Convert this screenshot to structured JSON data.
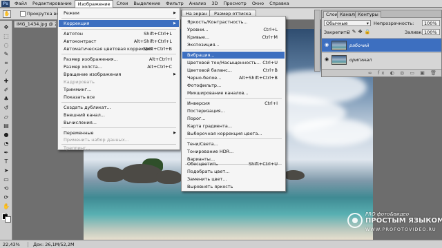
{
  "menubar": {
    "logo": "Ps",
    "items": [
      "Файл",
      "Редактирование",
      "Изображение",
      "Слои",
      "Выделение",
      "Фильтр",
      "Анализ",
      "3D",
      "Просмотр",
      "Окно",
      "Справка"
    ]
  },
  "options": {
    "checkbox_label": "Прокрутка во вс...",
    "btn_screen": "На экран",
    "btn_print": "Размер оттиска"
  },
  "document": {
    "tab": "IMG_1434.jpg @ 22,4..."
  },
  "status": {
    "zoom": "22,43%",
    "doc": "Док: 26,1M/52,2M"
  },
  "image_menu": {
    "items": [
      {
        "label": "Режим",
        "shortcut": "",
        "submenu": true
      },
      {
        "label": "Коррекция",
        "shortcut": "",
        "submenu": true,
        "highlight": true
      },
      {
        "label": "Автотон",
        "shortcut": "Shift+Ctrl+L"
      },
      {
        "label": "Автоконтраст",
        "shortcut": "Alt+Shift+Ctrl+L"
      },
      {
        "label": "Автоматическая цветовая коррекция",
        "shortcut": "Shift+Ctrl+B"
      },
      {
        "label": "Размер изображения...",
        "shortcut": "Alt+Ctrl+I"
      },
      {
        "label": "Размер холста...",
        "shortcut": "Alt+Ctrl+C"
      },
      {
        "label": "Вращение изображения",
        "shortcut": "",
        "submenu": true
      },
      {
        "label": "Кадрировать",
        "shortcut": "",
        "disabled": true
      },
      {
        "label": "Тримминг...",
        "shortcut": ""
      },
      {
        "label": "Показать все",
        "shortcut": ""
      },
      {
        "label": "Создать дубликат...",
        "shortcut": ""
      },
      {
        "label": "Внешний канал...",
        "shortcut": ""
      },
      {
        "label": "Вычисления...",
        "shortcut": ""
      },
      {
        "label": "Переменные",
        "shortcut": "",
        "submenu": true
      },
      {
        "label": "Применить набор данных...",
        "shortcut": "",
        "disabled": true
      },
      {
        "label": "Треппинг...",
        "shortcut": "",
        "disabled": true
      }
    ]
  },
  "adjust_menu": {
    "items": [
      {
        "label": "Яркость/Контрастность...",
        "shortcut": ""
      },
      {
        "label": "Уровни...",
        "shortcut": "Ctrl+L"
      },
      {
        "label": "Кривые...",
        "shortcut": "Ctrl+M"
      },
      {
        "label": "Экспозиция...",
        "shortcut": ""
      },
      {
        "label": "Вибрация...",
        "shortcut": "",
        "highlight": true
      },
      {
        "label": "Цветовой тон/Насыщенность...",
        "shortcut": "Ctrl+U"
      },
      {
        "label": "Цветовой баланс...",
        "shortcut": "Ctrl+B"
      },
      {
        "label": "Черно-белое...",
        "shortcut": "Alt+Shift+Ctrl+B"
      },
      {
        "label": "Фотофильтр...",
        "shortcut": ""
      },
      {
        "label": "Микширование каналов...",
        "shortcut": ""
      },
      {
        "label": "Инверсия",
        "shortcut": "Ctrl+I"
      },
      {
        "label": "Постеризация...",
        "shortcut": ""
      },
      {
        "label": "Порог...",
        "shortcut": ""
      },
      {
        "label": "Карта градиента...",
        "shortcut": ""
      },
      {
        "label": "Выборочная коррекция цвета...",
        "shortcut": ""
      },
      {
        "label": "Тени/Света...",
        "shortcut": ""
      },
      {
        "label": "Тонирование HDR...",
        "shortcut": ""
      },
      {
        "label": "Варианты...",
        "shortcut": ""
      },
      {
        "label": "Обесцветить",
        "shortcut": "Shift+Ctrl+U"
      },
      {
        "label": "Подобрать цвет...",
        "shortcut": ""
      },
      {
        "label": "Заменить цвет...",
        "shortcut": ""
      },
      {
        "label": "Выровнять яркость",
        "shortcut": ""
      }
    ]
  },
  "layers_panel": {
    "tabs": [
      "Слои",
      "Каналы",
      "Контуры"
    ],
    "blend_mode": "Обычные",
    "opacity_label": "Непрозрачность:",
    "opacity_value": "100%",
    "lock_label": "Закрепить:",
    "fill_label": "Заливка:",
    "fill_value": "100%",
    "layers": [
      {
        "name": "рабочий",
        "selected": true
      },
      {
        "name": "оригинал",
        "selected": false
      }
    ],
    "footer_icons": "∞ fx ◐ ◎ ▭ ▣ 🗑"
  },
  "watermark": {
    "line1": "PRO фото&видео",
    "line2": "ПРОСТЫМ ЯЗЫКОМ",
    "line3": "WWW.PROFOTOVIDEO.RU"
  },
  "colors": {
    "highlight": "#3d6fc0",
    "menu_bg": "#f5f5f5",
    "chrome": "#d6d6d6"
  }
}
